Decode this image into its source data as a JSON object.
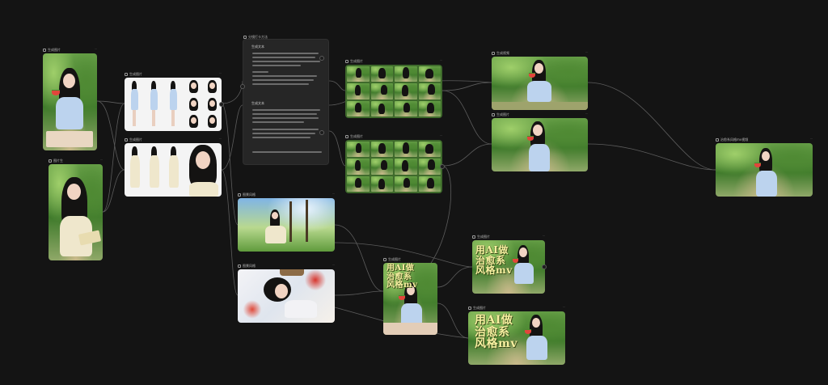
{
  "nodes": {
    "src_image": {
      "label": "生成图片"
    },
    "ref_image": {
      "label": "图片生"
    },
    "char_sheet_1": {
      "label": "生成图片"
    },
    "char_sheet_2": {
      "label": "生成图片"
    },
    "note": {
      "title": "分镜打卡方法",
      "section_1": "生成文本",
      "section_2": "生成文本"
    },
    "scene_1": {
      "label": "图景风格"
    },
    "scene_2": {
      "label": "图景风格"
    },
    "grid_1": {
      "label": "生成图片"
    },
    "grid_2": {
      "label": "生成图片"
    },
    "still_1": {
      "label": "生成视频"
    },
    "still_2": {
      "label": "生成图片"
    },
    "poster_tall": {
      "label": "生成图片",
      "text": "用AI做\n治愈系\n风格mv"
    },
    "poster_mid": {
      "label": "生成图片",
      "text": "用AI做\n治愈系\n风格mv"
    },
    "poster_wide": {
      "label": "生成图片",
      "text": "用AI做\n治愈系\n风格mv"
    },
    "final_video": {
      "label": "治愈系风格mv视频"
    }
  },
  "colors": {
    "canvas_bg": "#141414",
    "wire": "#5c5c5c",
    "calligraphy": "#f7f0a0"
  }
}
